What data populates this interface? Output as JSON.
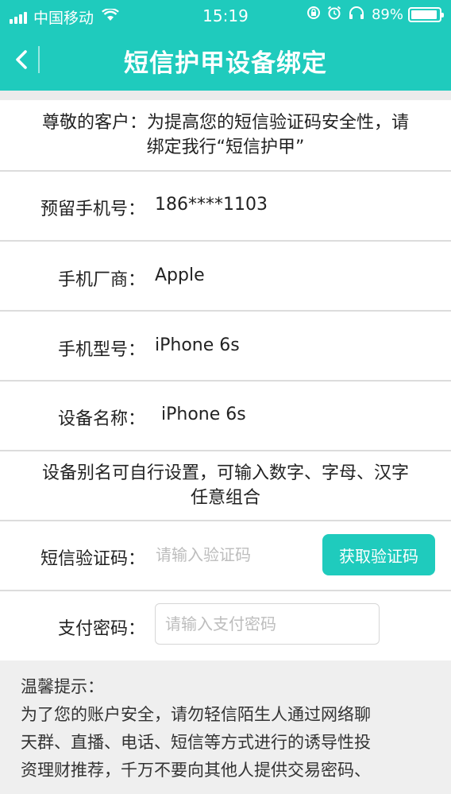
{
  "status_bar": {
    "carrier": "中国移动",
    "time": "15:19",
    "battery": "89%",
    "battery_level": 0.89,
    "icons": [
      "signal-icon",
      "wifi-icon",
      "rotation-lock-icon",
      "alarm-icon",
      "headphones-icon",
      "battery-icon"
    ]
  },
  "nav": {
    "title": "短信护甲设备绑定",
    "back_icon": "chevron-left-icon"
  },
  "notice": {
    "text_line1": "尊敬的客户：为提高您的短信验证码安全性，请",
    "text_line2": "绑定我行“短信护甲”"
  },
  "fields": {
    "phone_label": "预留手机号：",
    "phone_value": "186****1103",
    "maker_label": "手机厂商：",
    "maker_value": "Apple",
    "model_label": "手机型号：",
    "model_value": "iPhone 6s",
    "device_label": "设备名称：",
    "device_value": "iPhone 6s"
  },
  "alias_hint": {
    "line1": "设备别名可自行设置，可输入数字、字母、汉字",
    "line2": "任意组合"
  },
  "sms": {
    "label": "短信验证码：",
    "placeholder": "请输入验证码",
    "value": "",
    "button_label": "获取验证码"
  },
  "password": {
    "label": "支付密码：",
    "placeholder": "请输入支付密码",
    "value": ""
  },
  "tips": {
    "title": "温馨提示：",
    "line1": "为了您的账户安全，请勿轻信陌生人通过网络聊",
    "line2": "天群、直播、电话、短信等方式进行的诱导性投",
    "line3": "资理财推荐，千万不要向其他人提供交易密码、"
  },
  "colors": {
    "brand": "#1fcbbd",
    "background_gray": "#ebebeb",
    "divider": "#dcdcdc",
    "placeholder": "#bdbdbd"
  }
}
